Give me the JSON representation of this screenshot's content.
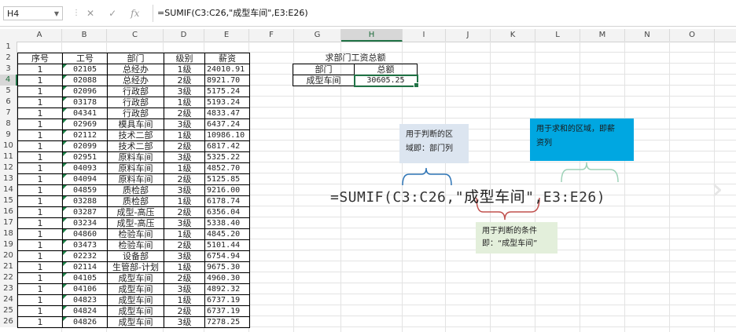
{
  "formula_bar": {
    "name_box": "H4",
    "formula": "=SUMIF(C3:C26,\"成型车间\",E3:E26)",
    "icons": [
      "cancel-icon",
      "enter-icon",
      "function-icon"
    ]
  },
  "columns": [
    "A",
    "B",
    "C",
    "D",
    "E",
    "F",
    "G",
    "H",
    "I",
    "J",
    "K",
    "L",
    "M",
    "N",
    "O"
  ],
  "rows": [
    "1",
    "2",
    "3",
    "4",
    "5",
    "6",
    "7",
    "8",
    "9",
    "10",
    "11",
    "12",
    "13",
    "14",
    "15",
    "16",
    "17",
    "18",
    "19",
    "20",
    "21",
    "22",
    "23",
    "24",
    "25",
    "26"
  ],
  "table": {
    "headers": [
      "序号",
      "工号",
      "部门",
      "级别",
      "薪资"
    ],
    "rows": [
      [
        "1",
        "02105",
        "总经办",
        "1级",
        "24010.91"
      ],
      [
        "1",
        "02088",
        "总经办",
        "2级",
        "8921.70"
      ],
      [
        "1",
        "02096",
        "行政部",
        "3级",
        "5175.24"
      ],
      [
        "1",
        "03178",
        "行政部",
        "1级",
        "5193.24"
      ],
      [
        "1",
        "04341",
        "行政部",
        "2级",
        "4833.47"
      ],
      [
        "1",
        "02969",
        "模具车间",
        "3级",
        "6437.24"
      ],
      [
        "1",
        "02112",
        "技术二部",
        "1级",
        "10986.10"
      ],
      [
        "1",
        "02099",
        "技术二部",
        "2级",
        "6817.42"
      ],
      [
        "1",
        "02951",
        "原料车间",
        "3级",
        "5325.22"
      ],
      [
        "1",
        "04093",
        "原料车间",
        "1级",
        "4852.70"
      ],
      [
        "1",
        "04094",
        "原料车间",
        "2级",
        "5125.85"
      ],
      [
        "1",
        "04859",
        "质检部",
        "3级",
        "9216.00"
      ],
      [
        "1",
        "03288",
        "质检部",
        "1级",
        "6178.74"
      ],
      [
        "1",
        "03287",
        "成型-高压",
        "2级",
        "6356.04"
      ],
      [
        "1",
        "03234",
        "成型-高压",
        "3级",
        "5338.40"
      ],
      [
        "1",
        "04860",
        "检验车间",
        "1级",
        "4845.20"
      ],
      [
        "1",
        "03473",
        "检验车间",
        "2级",
        "5101.44"
      ],
      [
        "1",
        "02232",
        "设备部",
        "3级",
        "6754.94"
      ],
      [
        "1",
        "02114",
        "生管部-计划",
        "1级",
        "9675.30"
      ],
      [
        "1",
        "04105",
        "成型车间",
        "2级",
        "4960.30"
      ],
      [
        "1",
        "04106",
        "成型车间",
        "3级",
        "4892.32"
      ],
      [
        "1",
        "04823",
        "成型车间",
        "1级",
        "6737.19"
      ],
      [
        "1",
        "04824",
        "成型车间",
        "2级",
        "6737.19"
      ],
      [
        "1",
        "04826",
        "成型车间",
        "3级",
        "7278.25"
      ]
    ]
  },
  "summary": {
    "title": "求部门工资总额",
    "header_dept": "部门",
    "header_total": "总额",
    "dept": "成型车间",
    "total": "30605.25"
  },
  "annotation": {
    "big_formula_prefix": "=SUMIF(C3:C26,\"",
    "big_formula_cn": "成型车间",
    "big_formula_suffix": "\",E3:E26)",
    "box1_line1": "用于判断的区",
    "box1_line2": "域即：部门列",
    "box2_line1": "用于求和的区域，即薪",
    "box2_line2": "资列",
    "box3_line1": "用于判断的条件",
    "box3_line2": "即：“成型车间”"
  },
  "colors": {
    "selection": "#217346",
    "box1": "#dce5f0",
    "box2": "#00a7e1",
    "box3": "#e3efdb",
    "brace1": "#2e75b6",
    "brace2": "#9ed2b8",
    "brace3": "#c0504d"
  }
}
